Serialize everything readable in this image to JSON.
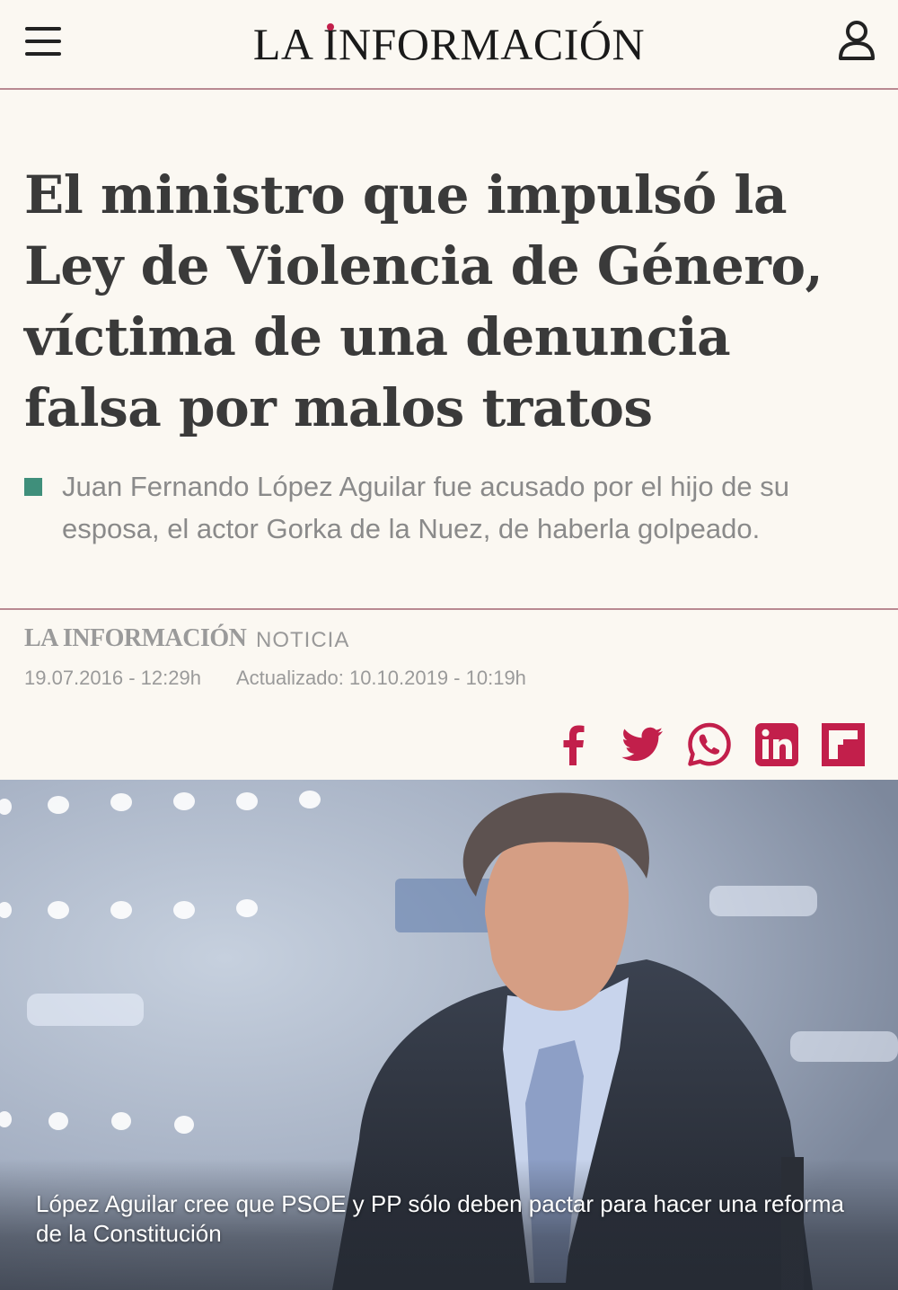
{
  "header": {
    "logo_prefix": "LA ",
    "logo_i": "I",
    "logo_mid": "NFORMACI",
    "logo_i2": "Ó",
    "logo_end": "N",
    "menu_icon": "hamburger-menu-icon",
    "user_icon": "user-account-icon",
    "accent": "#c21f4b"
  },
  "article": {
    "headline": "El ministro que impulsó la Ley de Violencia de Género, víctima de una denuncia falsa por malos tratos",
    "subtitle": "Juan Fernando López Aguilar fue acusado por el hijo de su esposa, el actor Gorka de la Nuez, de haberla golpeado.",
    "subtitle_marker_color": "#3f8f7b",
    "source": "LA INFORMACIÓN",
    "type": "NOTICIA",
    "date": "19.07.2016 - 12:29h",
    "updated": "Actualizado: 10.10.2019 - 10:19h",
    "caption": "López Aguilar cree que PSOE y PP sólo deben pactar para hacer una reforma de la Constitución"
  },
  "share": {
    "color": "#c21f4b",
    "buttons": [
      "facebook-icon",
      "twitter-icon",
      "whatsapp-icon",
      "linkedin-icon",
      "flipboard-icon"
    ]
  }
}
